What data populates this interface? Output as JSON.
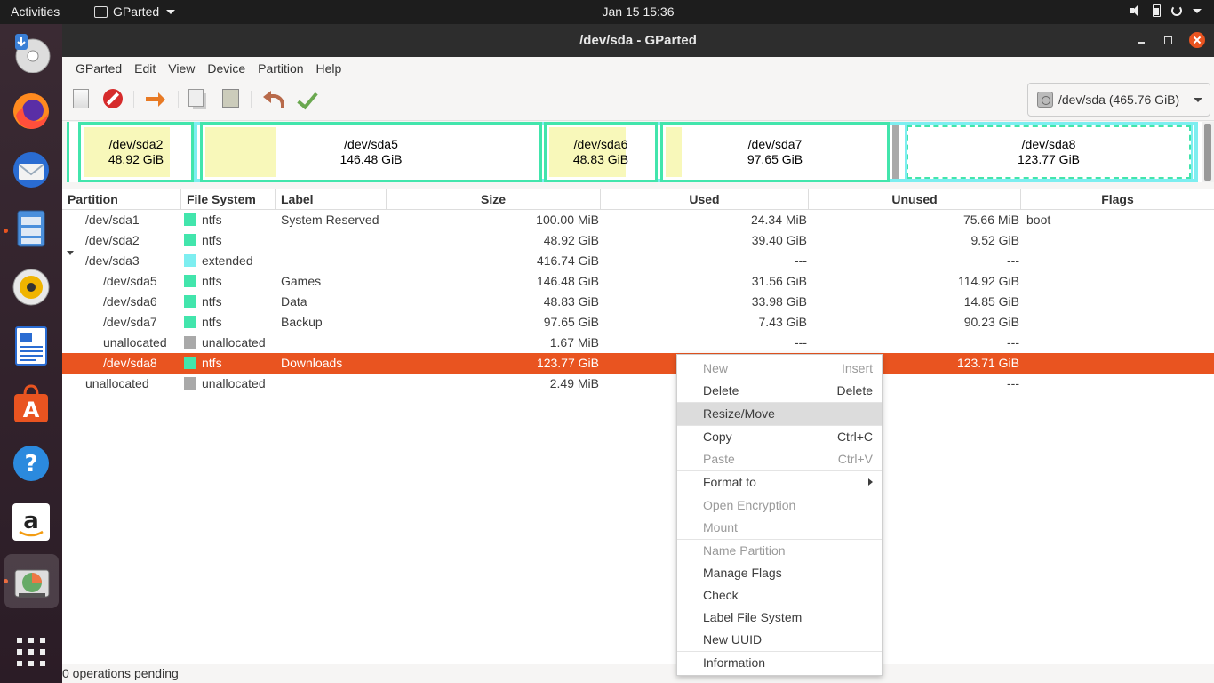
{
  "topbar": {
    "activities": "Activities",
    "app_name": "GParted",
    "clock": "Jan 15  15:36"
  },
  "window": {
    "title": "/dev/sda - GParted"
  },
  "menubar": [
    "GParted",
    "Edit",
    "View",
    "Device",
    "Partition",
    "Help"
  ],
  "device_select": "/dev/sda  (465.76 GiB)",
  "graph": [
    {
      "name": "/dev/sda2",
      "size": "48.92 GiB"
    },
    {
      "name": "/dev/sda5",
      "size": "146.48 GiB"
    },
    {
      "name": "/dev/sda6",
      "size": "48.83 GiB"
    },
    {
      "name": "/dev/sda7",
      "size": "97.65 GiB"
    },
    {
      "name": "/dev/sda8",
      "size": "123.77 GiB"
    }
  ],
  "columns": [
    "Partition",
    "File System",
    "Label",
    "Size",
    "Used",
    "Unused",
    "Flags"
  ],
  "rows": [
    {
      "partition": "/dev/sda1",
      "fs": "ntfs",
      "label": "System Reserved",
      "size": "100.00 MiB",
      "used": "24.34 MiB",
      "unused": "75.66 MiB",
      "flags": "boot"
    },
    {
      "partition": "/dev/sda2",
      "fs": "ntfs",
      "label": "",
      "size": "48.92 GiB",
      "used": "39.40 GiB",
      "unused": "9.52 GiB",
      "flags": ""
    },
    {
      "partition": "/dev/sda3",
      "fs": "extended",
      "label": "",
      "size": "416.74 GiB",
      "used": "---",
      "unused": "---",
      "flags": ""
    },
    {
      "partition": "/dev/sda5",
      "fs": "ntfs",
      "label": "Games",
      "size": "146.48 GiB",
      "used": "31.56 GiB",
      "unused": "114.92 GiB",
      "flags": ""
    },
    {
      "partition": "/dev/sda6",
      "fs": "ntfs",
      "label": "Data",
      "size": "48.83 GiB",
      "used": "33.98 GiB",
      "unused": "14.85 GiB",
      "flags": ""
    },
    {
      "partition": "/dev/sda7",
      "fs": "ntfs",
      "label": "Backup",
      "size": "97.65 GiB",
      "used": "7.43 GiB",
      "unused": "90.23 GiB",
      "flags": ""
    },
    {
      "partition": "unallocated",
      "fs": "unallocated",
      "label": "",
      "size": "1.67 MiB",
      "used": "---",
      "unused": "---",
      "flags": ""
    },
    {
      "partition": "/dev/sda8",
      "fs": "ntfs",
      "label": "Downloads",
      "size": "123.77 GiB",
      "used": "",
      "unused": "123.71 GiB",
      "flags": ""
    },
    {
      "partition": "unallocated",
      "fs": "unallocated",
      "label": "",
      "size": "2.49 MiB",
      "used": "",
      "unused": "---",
      "flags": ""
    }
  ],
  "colors": {
    "ntfs": "#42e5ac",
    "extended": "#7deef0",
    "unallocated": "#a9a9a9",
    "selection": "#e95420",
    "used_fill": "#f8f8ba"
  },
  "status": "0 operations pending",
  "context_menu": {
    "new": "New",
    "new_acc": "Insert",
    "delete": "Delete",
    "delete_acc": "Delete",
    "resize": "Resize/Move",
    "copy": "Copy",
    "copy_acc": "Ctrl+C",
    "paste": "Paste",
    "paste_acc": "Ctrl+V",
    "format": "Format to",
    "encryption": "Open Encryption",
    "mount": "Mount",
    "name_partition": "Name Partition",
    "manage_flags": "Manage Flags",
    "check": "Check",
    "label_fs": "Label File System",
    "new_uuid": "New UUID",
    "information": "Information"
  },
  "icons": {
    "toolbar": [
      "new-partition-icon",
      "delete-icon",
      "resize-move-icon",
      "copy-icon",
      "paste-icon",
      "undo-icon",
      "apply-icon"
    ],
    "dock": [
      "installer-icon",
      "firefox-icon",
      "thunderbird-icon",
      "files-icon",
      "rhythmbox-icon",
      "writer-icon",
      "software-icon",
      "help-icon",
      "amazon-icon",
      "gparted-icon",
      "app-grid-icon"
    ]
  }
}
